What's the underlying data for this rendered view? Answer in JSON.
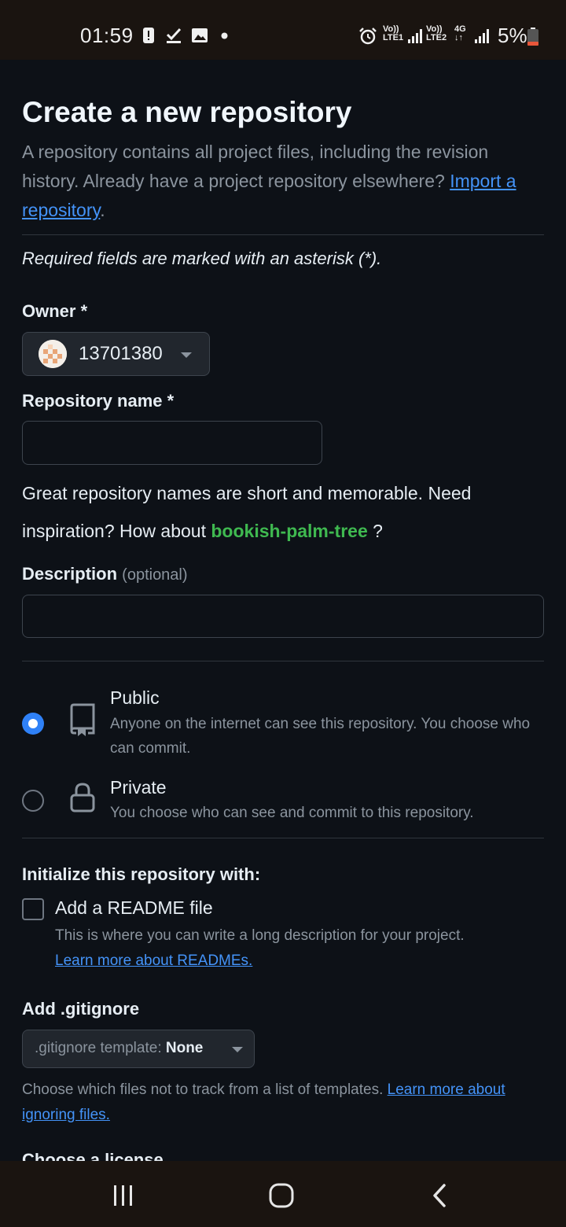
{
  "status_bar": {
    "time": "01:59",
    "net1_top": "Vo))",
    "net1_bottom": "LTE1",
    "net2_top": "Vo))",
    "net2_bottom": "LTE2",
    "net3_top": "4G",
    "battery": "5%"
  },
  "page": {
    "title": "Create a new repository",
    "intro_text": "A repository contains all project files, including the revision history. Already have a project repository elsewhere?",
    "import_link": "Import a repository",
    "intro_end": ".",
    "required_note": "Required fields are marked with an asterisk (*)."
  },
  "owner": {
    "label": "Owner *",
    "value": "13701380"
  },
  "repo_name": {
    "label": "Repository name *",
    "value": "",
    "hint_prefix": "Great repository names are short and memorable. Need inspiration? How about",
    "suggestion": "bookish-palm-tree",
    "hint_suffix": " ?"
  },
  "description": {
    "label": "Description",
    "optional": "(optional)",
    "value": ""
  },
  "visibility": {
    "public_title": "Public",
    "public_desc": "Anyone on the internet can see this repository. You choose who can commit.",
    "private_title": "Private",
    "private_desc": "You choose who can see and commit to this repository.",
    "selected": "Public"
  },
  "init": {
    "heading": "Initialize this repository with:",
    "readme_label": "Add a README file",
    "readme_desc": "This is where you can write a long description for your project.",
    "readme_link": "Learn more about READMEs.",
    "readme_checked": false
  },
  "gitignore": {
    "heading": "Add .gitignore",
    "select_label": ".gitignore template:",
    "select_value": "None",
    "hint": "Choose which files not to track from a list of templates.",
    "hint_link": "Learn more about ignoring files."
  },
  "cutoff_heading": "Choose a license",
  "colors": {
    "background": "#0d1117",
    "link": "#4493f8",
    "suggestion": "#3fb950",
    "radio_selected": "#2f81f7"
  }
}
